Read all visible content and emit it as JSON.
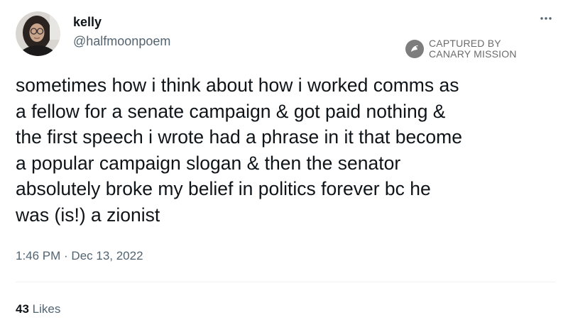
{
  "tweet": {
    "author": {
      "display_name": "kelly",
      "handle": "@halfmoonpoem"
    },
    "text": "sometimes how i think about how i worked comms as\na fellow for a senate campaign & got paid nothing &\nthe first speech i wrote had a phrase in it that become\na popular campaign slogan & then the senator\nabsolutely broke my belief in politics forever bc he\nwas (is!) a zionist",
    "timestamp": "1:46 PM",
    "separator": " · ",
    "date": "Dec 13, 2022",
    "likes": {
      "count": "43",
      "label": "Likes"
    }
  },
  "watermark": {
    "line1": "CAPTURED BY",
    "line2": "CANARY MISSION",
    "icon": "canary-mission-logo-icon"
  },
  "icons": {
    "more": "more-options-icon",
    "avatar": "profile-avatar"
  },
  "colors": {
    "text_primary": "#0f1419",
    "text_secondary": "#536471",
    "watermark": "#6b6b6b",
    "divider": "#eff3f4"
  }
}
